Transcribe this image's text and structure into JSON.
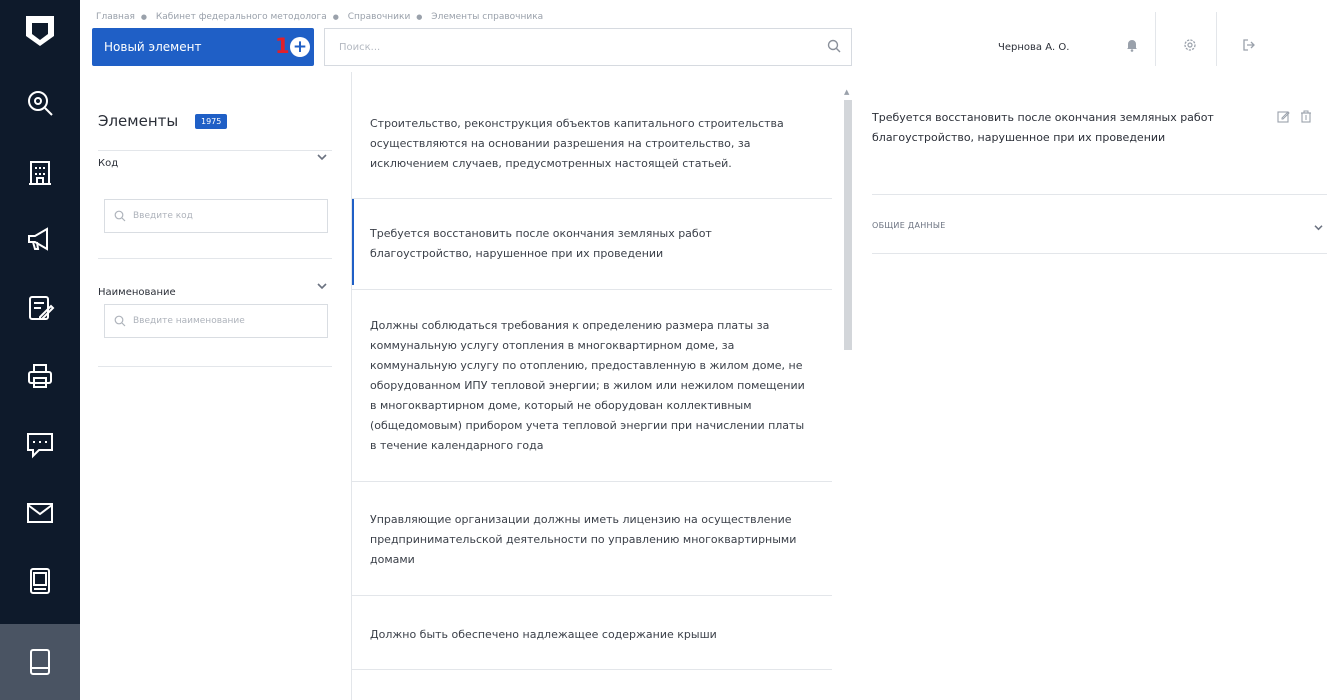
{
  "breadcrumb": [
    "Главная",
    "Кабинет федерального методолога",
    "Справочники",
    "Элементы справочника"
  ],
  "toolbar": {
    "new_element_label": "Новый элемент",
    "step_marker": "1",
    "search_placeholder": "Поиск..."
  },
  "user": {
    "name": "Чернова А. О."
  },
  "header_icons": [
    "bell-icon",
    "settings-icon",
    "logout-icon"
  ],
  "rail": {
    "items": [
      "search-icon",
      "building-icon",
      "megaphone-icon",
      "checklist-icon",
      "printer-icon",
      "chat-icon",
      "mail-icon",
      "book-stack-icon",
      "book-icon"
    ],
    "active_index": 8
  },
  "filters": {
    "title": "Элементы",
    "count": "1975",
    "code": {
      "label": "Код",
      "placeholder": "Введите код"
    },
    "name": {
      "label": "Наименование",
      "placeholder": "Введите наименование"
    }
  },
  "list": {
    "items": [
      "Строительство, реконструкция объектов капитального строительства осуществляются на основании разрешения на строительство, за исключением случаев, предусмотренных настоящей статьей.",
      "Требуется восстановить после окончания земляных работ благоустройство, нарушенное при их проведении",
      "Должны соблюдаться требования к определению размера платы за коммунальную услугу отопления в многоквартирном доме, за коммунальную услугу по отоплению, предоставленную в жилом доме, не оборудованном ИПУ тепловой энергии; в жилом или нежилом помещении в многоквартирном доме, который не оборудован коллективным (общедомовым) прибором учета тепловой энергии при начислении платы в течение календарного года",
      "Управляющие организации должны иметь лицензию на осуществление предпринимательской деятельности по управлению многоквартирными домами",
      "Должно быть обеспечено надлежащее содержание крыши"
    ],
    "selected_index": 1
  },
  "detail": {
    "title": "Требуется восстановить после окончания земляных работ благоустройство, нарушенное при их проведении",
    "section_label": "ОБЩИЕ ДАННЫЕ"
  },
  "colors": {
    "rail_bg": "#0e1a2b",
    "accent": "#1f5fc6",
    "step_marker": "#e0202a",
    "rail_active": "#4a5463"
  }
}
